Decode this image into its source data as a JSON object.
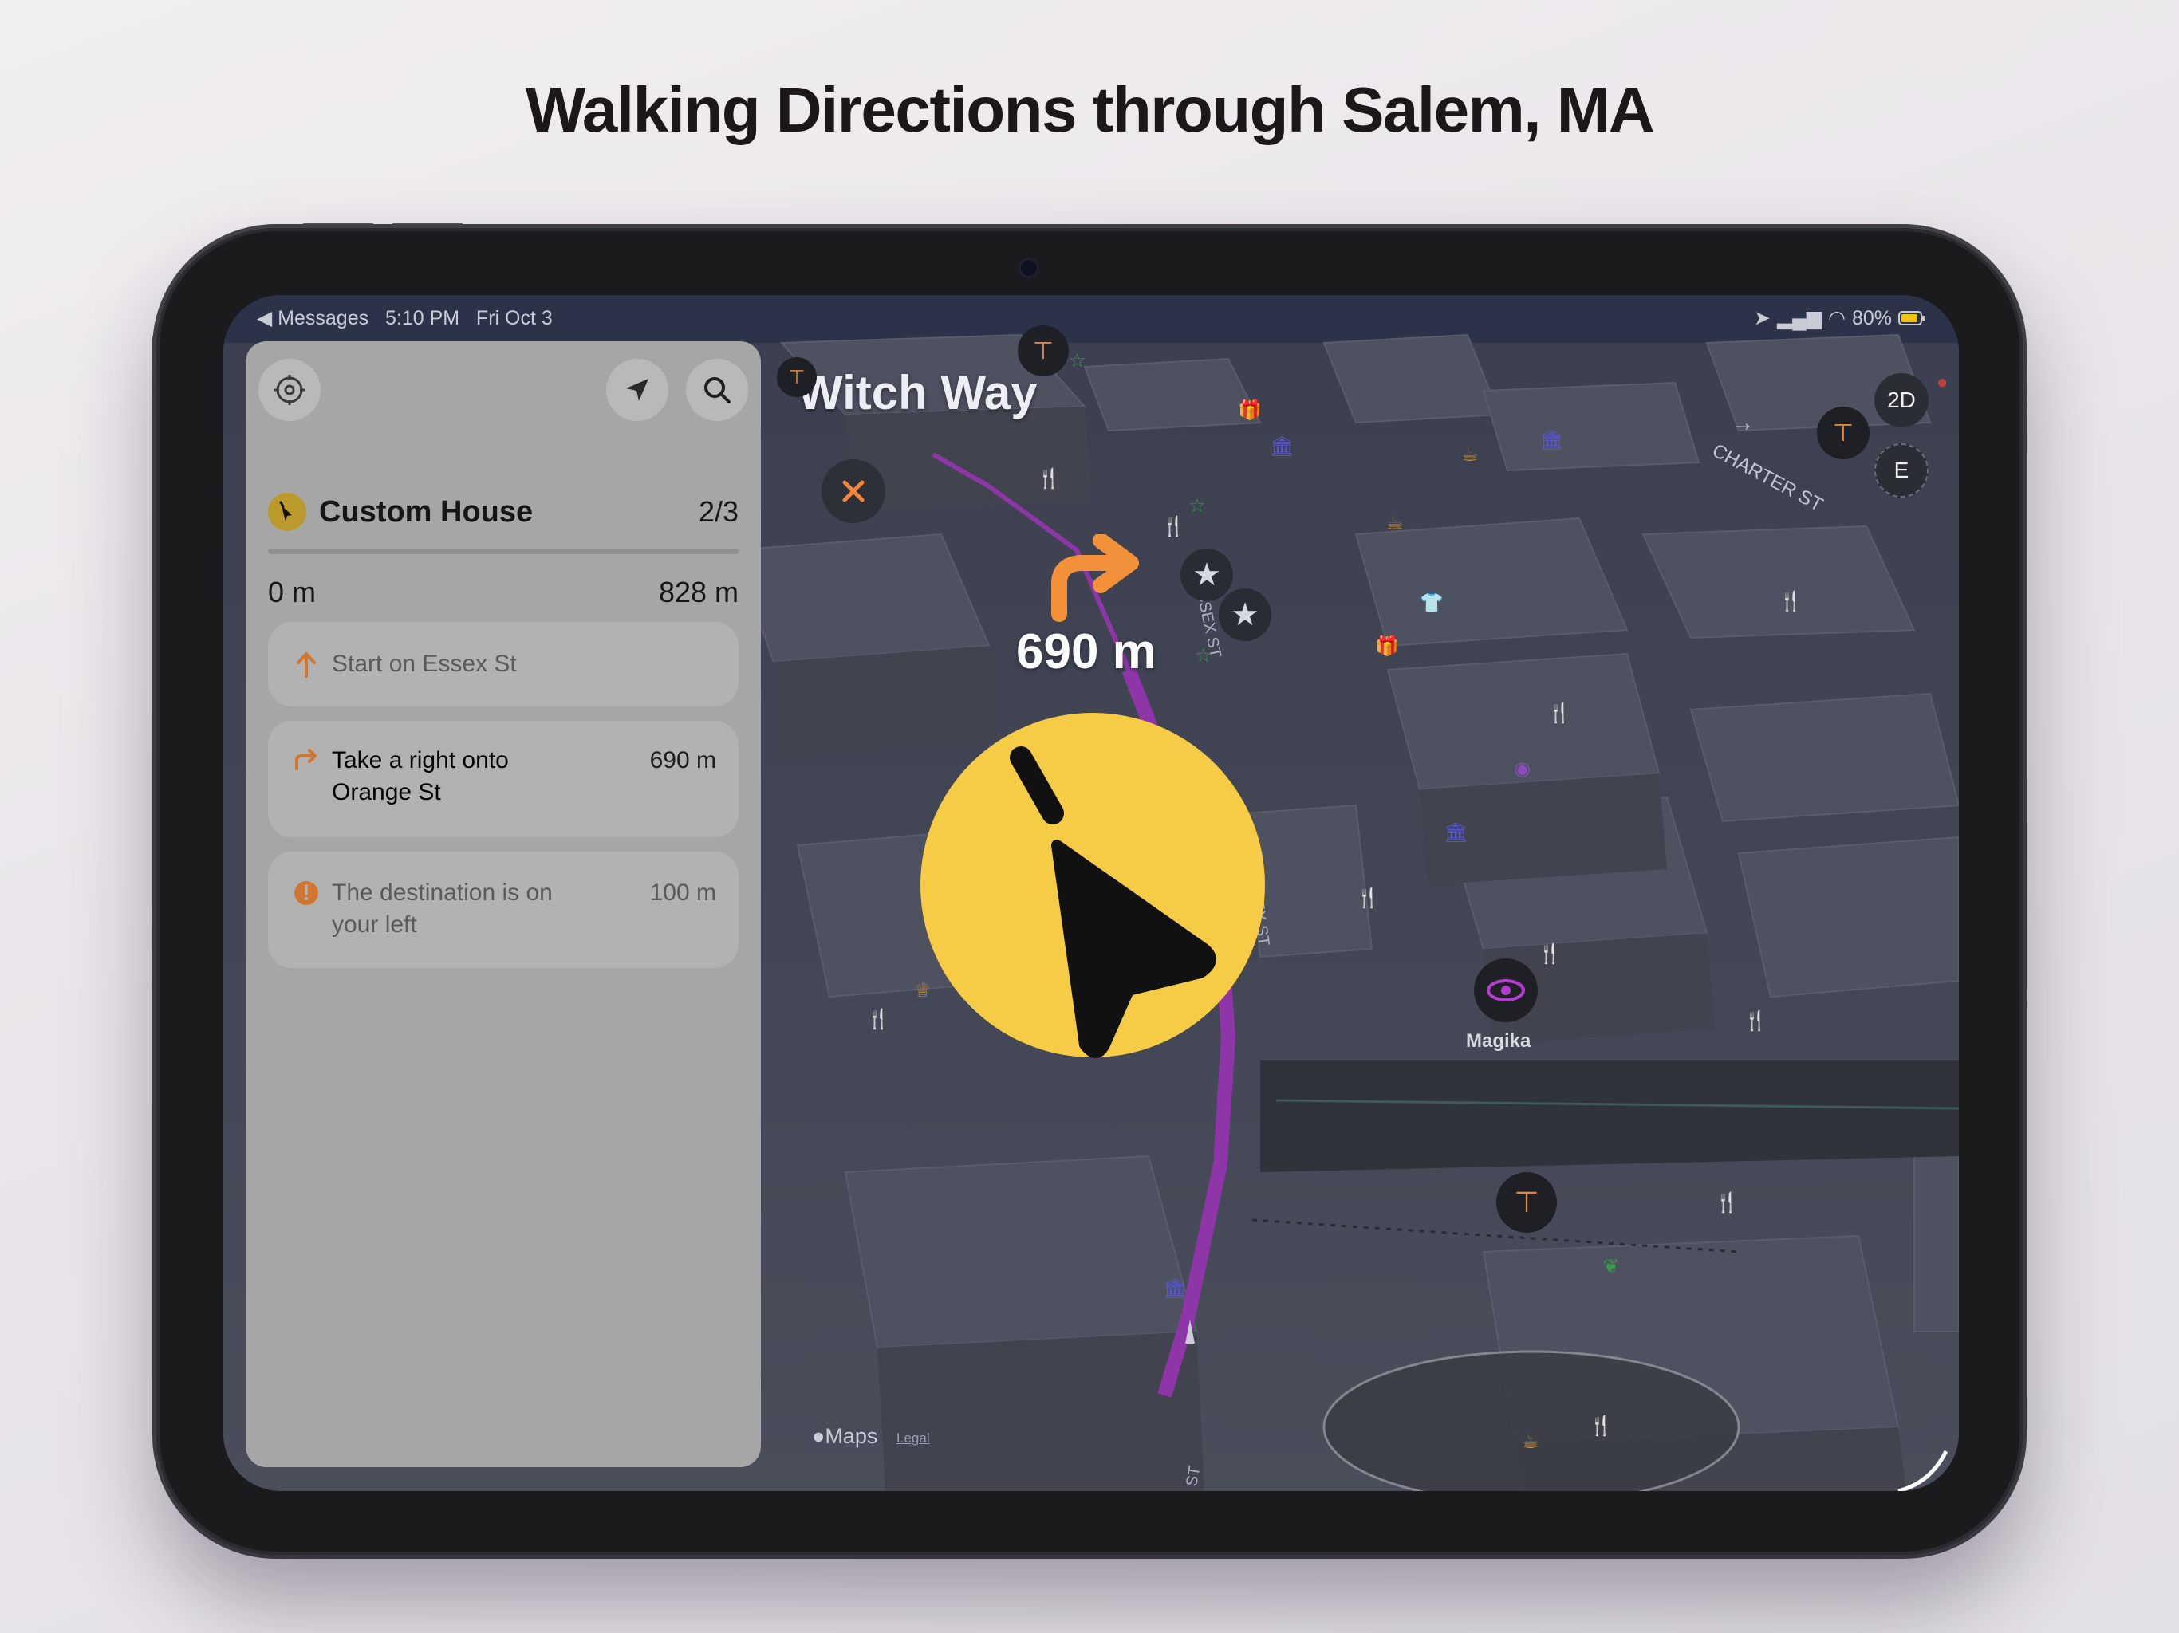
{
  "headline": "Walking Directions through Salem, MA",
  "status_bar": {
    "back_app": "◀ Messages",
    "time": "5:10 PM",
    "date": "Fri Oct 3",
    "battery": "80%"
  },
  "map": {
    "title": "Witch Way",
    "maneuver_distance": "690 m",
    "view_mode_button": "2D",
    "compass_heading": "E",
    "poi_magika": "Magika",
    "attribution": "Maps",
    "legal": "Legal",
    "street_labels": [
      "ESSEX ST",
      "ESSEX ST",
      "CHARTER ST",
      "ST"
    ],
    "route_color": "#8e35a8",
    "pointer_color": "#f6cc46"
  },
  "panel": {
    "destination": "Custom House",
    "stop_counter": "2/3",
    "start_distance": "0 m",
    "total_distance": "828 m",
    "progress": 0.0,
    "steps": [
      {
        "text": "Start on Essex St",
        "distance": "",
        "icon": "arrow-up-icon"
      },
      {
        "text_line1": "Take a right onto",
        "text_line2": "Orange St",
        "distance": "690 m",
        "icon": "turn-right-icon"
      },
      {
        "text_line1": "The destination is on",
        "text_line2": "your left",
        "distance": "100 m",
        "icon": "destination-pin-icon"
      }
    ]
  }
}
